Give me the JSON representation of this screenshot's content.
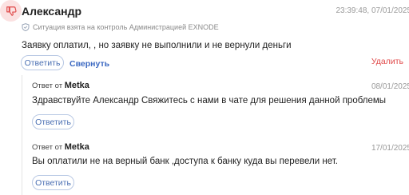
{
  "review": {
    "author": "Александр",
    "date": "23:39:48, 07/01/2025",
    "notice": "Ситуация взята на контроль Администрацией EXNODE",
    "text": "Заявку оплатил, , но заявку не выполнили и не вернули деньги",
    "reply_label": "Ответить",
    "collapse_label": "Свернуть",
    "delete_label": "Удалить",
    "icon": "thumbs-down-icon",
    "accent_color": "#e04a4a"
  },
  "replies": [
    {
      "from_prefix": "Ответ от",
      "from_name": "Metka",
      "date": "08/01/2025",
      "text": "Здравствуйте Александр Свяжитесь с нами в чате для решения данной проблемы",
      "reply_label": "Ответить"
    },
    {
      "from_prefix": "Ответ от",
      "from_name": "Metka",
      "date": "17/01/2025",
      "text": "Вы оплатили не на верный банк ,доступа к банку куда вы перевели нет.",
      "reply_label": "Ответить"
    }
  ]
}
